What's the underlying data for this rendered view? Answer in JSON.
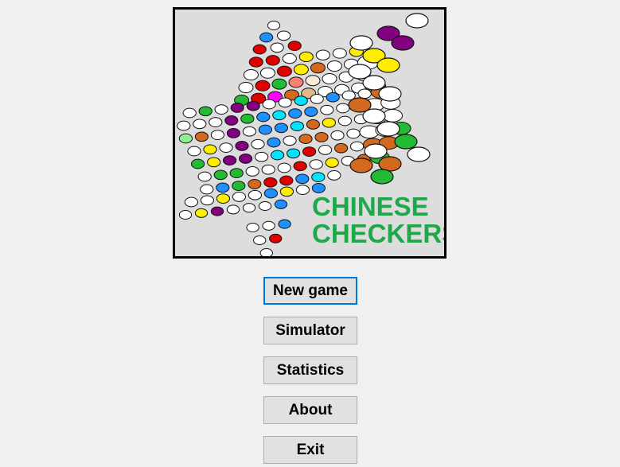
{
  "logo": {
    "title_line1": "CHINESE",
    "title_line2": "CHECKERS",
    "title_color": "#1fa84a",
    "background_color": "#dddddd",
    "marble_colors": [
      "#ffffff",
      "#e00000",
      "#ffee00",
      "#1e90ff",
      "#22bb33",
      "#800080",
      "#d2691e",
      "#00e5ff",
      "#ff00ff",
      "#fa8072",
      "#deb887",
      "#90ee90",
      "#faebd7"
    ]
  },
  "menu": {
    "new_game": "New game",
    "simulator": "Simulator",
    "statistics": "Statistics",
    "about": "About",
    "exit": "Exit",
    "focused_item": "New game",
    "focus_color": "#0078d7"
  }
}
